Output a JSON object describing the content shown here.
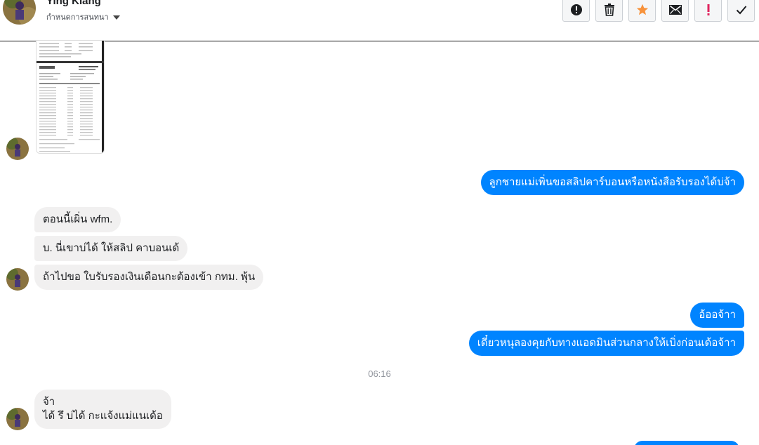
{
  "header": {
    "contact_name": "Ying Kiang",
    "settings_label": "กำหนดการสนทนา"
  },
  "toolbar": {
    "buttons": [
      {
        "name": "report",
        "icon": "exclamation-circle-icon"
      },
      {
        "name": "delete",
        "icon": "trash-icon"
      },
      {
        "name": "star",
        "icon": "star-icon",
        "color": "#f7923b"
      },
      {
        "name": "email",
        "icon": "envelope-icon"
      },
      {
        "name": "important",
        "icon": "exclamation-icon",
        "color": "#e0245e"
      },
      {
        "name": "done",
        "icon": "check-icon"
      }
    ]
  },
  "messages": {
    "out1": "ลูกชายแม่เพิ่นขอสลิปคาร์บอนหรือหนังสือรับรองได้บ่จ้า",
    "in1": "ตอนนี้เผิ่น wfm.",
    "in2": "บ. นี่เขาบ่ได้ ให้สลิป คาบอนเด้",
    "in3": "ถ้าไปขอ ใบรับรองเงินเดือนกะต้องเข้า กทม. พุ้น",
    "out2": "อ้ออจ้าา",
    "out3": "เดี๋ยวหนุลองคุยกับทางแอดมินส่วนกลางให้เบิ่งก่อนเด้อจ้าา",
    "timestamp": "06:16",
    "in4_line1": "จ้า",
    "in4_line2": "ได้ รึ บ่ได้ กะแจ้งแม่แนเด้อ"
  },
  "colors": {
    "outgoing": "#0084ff",
    "incoming": "#f1f0f0",
    "star": "#f7923b",
    "important": "#e0245e"
  }
}
